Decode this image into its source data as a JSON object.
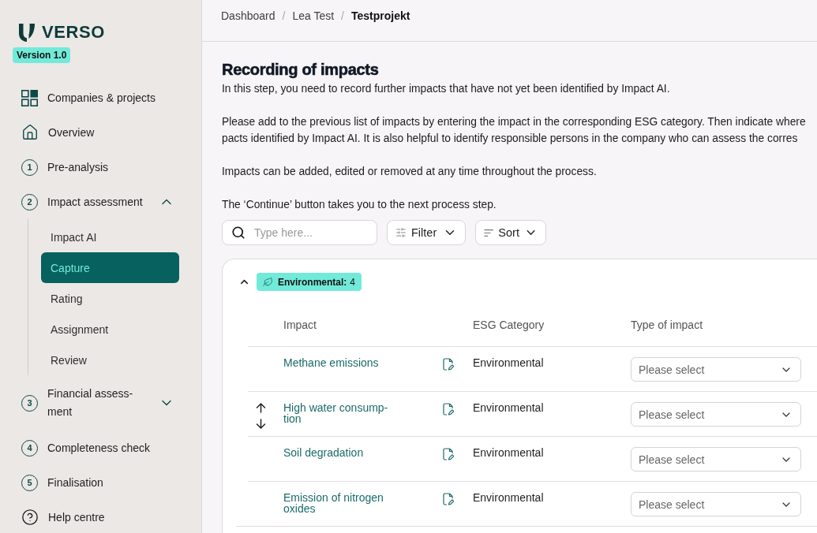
{
  "sidebar": {
    "logo": "VERSO",
    "version": "Version 1.0",
    "items": [
      {
        "kind": "projects",
        "label": "Companies & projects",
        "selected": false
      },
      {
        "kind": "overview",
        "label": "Overview",
        "selected": false
      },
      {
        "kind": "step",
        "step": "1",
        "label": "Pre-analysis",
        "selected": false
      },
      {
        "kind": "step",
        "step": "2",
        "label": "Impact assessment",
        "selected": false,
        "expanded": true,
        "children": [
          {
            "label": "Impact AI",
            "selected": false
          },
          {
            "label": "Capture",
            "selected": true
          },
          {
            "label": "Rating",
            "selected": false
          },
          {
            "label": "Assignment",
            "selected": false
          },
          {
            "label": "Review",
            "selected": false
          }
        ]
      },
      {
        "kind": "step",
        "step": "3",
        "label": "Financial assess-ment",
        "selected": false,
        "expanded": false
      },
      {
        "kind": "step",
        "step": "4",
        "label": "Completeness check",
        "selected": false
      },
      {
        "kind": "step",
        "step": "5",
        "label": "Finalisation",
        "selected": false
      },
      {
        "kind": "help",
        "label": "Help centre",
        "selected": false
      }
    ]
  },
  "header": {
    "breadcrumb": [
      {
        "kind": "crumb",
        "label": "Dashboard",
        "current": false
      },
      {
        "kind": "separator",
        "label": "/"
      },
      {
        "kind": "crumb",
        "label": "Lea Test",
        "current": false
      },
      {
        "kind": "separator",
        "label": "/"
      },
      {
        "kind": "crumb",
        "label": "Testprojekt",
        "current": true
      }
    ]
  },
  "page": {
    "title": "Recording of impacts",
    "paragraphs": [
      {
        "lines": [
          "In this step, you need to record further impacts that have not yet been identified by Impact AI."
        ]
      },
      {
        "lines": [
          "Please add to the previous list of impacts by entering the impact in the corresponding ESG category. Then indicate where",
          "pacts identified by Impact AI. It is also helpful to identify responsible persons in the company who can assess the corres"
        ]
      },
      {
        "lines": [
          "Impacts can be added, edited or removed at any time throughout the process."
        ]
      },
      {
        "lines": [
          "The ‘Continue’ button takes you to the next process step."
        ]
      }
    ]
  },
  "toolbar": {
    "search": {
      "placeholder": "Type here..."
    },
    "filter": {
      "label": "Filter"
    },
    "sort": {
      "label": "Sort"
    }
  },
  "groups": [
    {
      "label": "Environmental:",
      "count": "4",
      "expanded": true,
      "columns": [
        "Impact",
        "ESG Category",
        "Type of impact"
      ],
      "rows": [
        {
          "impact": "Methane emissions",
          "esg_category": "Environmental",
          "type_of_impact": {
            "placeholder": "Please select"
          },
          "hovered": false
        },
        {
          "impact": "High water consump-tion",
          "esg_category": "Environmental",
          "type_of_impact": {
            "placeholder": "Please select"
          },
          "hovered": true
        },
        {
          "impact": "Soil degradation",
          "esg_category": "Environmental",
          "type_of_impact": {
            "placeholder": "Please select"
          },
          "hovered": false
        },
        {
          "impact": "Emission of nitrogen oxides",
          "esg_category": "Environmental",
          "type_of_impact": {
            "placeholder": "Please select"
          },
          "hovered": false
        }
      ]
    }
  ]
}
